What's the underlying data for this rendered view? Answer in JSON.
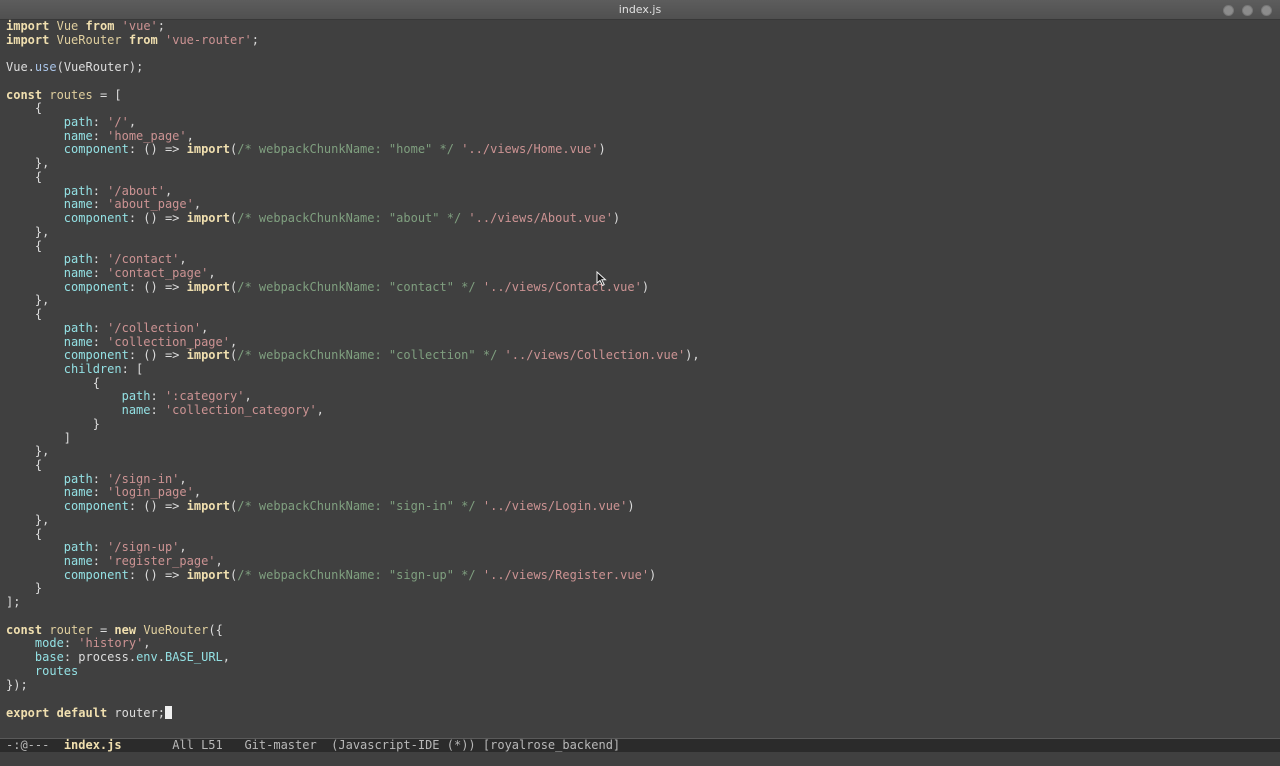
{
  "window": {
    "title": "index.js"
  },
  "code": [
    [
      [
        "kw",
        "import"
      ],
      [
        "punc",
        " "
      ],
      [
        "cls",
        "Vue"
      ],
      [
        "punc",
        " "
      ],
      [
        "kw",
        "from"
      ],
      [
        "punc",
        " "
      ],
      [
        "str",
        "'vue'"
      ],
      [
        "punc",
        ";"
      ]
    ],
    [
      [
        "kw",
        "import"
      ],
      [
        "punc",
        " "
      ],
      [
        "cls",
        "VueRouter"
      ],
      [
        "punc",
        " "
      ],
      [
        "kw",
        "from"
      ],
      [
        "punc",
        " "
      ],
      [
        "str",
        "'vue-router'"
      ],
      [
        "punc",
        ";"
      ]
    ],
    [],
    [
      [
        "punc",
        "Vue."
      ],
      [
        "fn",
        "use"
      ],
      [
        "punc",
        "(VueRouter);"
      ]
    ],
    [],
    [
      [
        "kw",
        "const"
      ],
      [
        "punc",
        " "
      ],
      [
        "var",
        "routes"
      ],
      [
        "punc",
        " = ["
      ]
    ],
    [
      [
        "punc",
        "    {"
      ]
    ],
    [
      [
        "punc",
        "        "
      ],
      [
        "prop",
        "path"
      ],
      [
        "punc",
        ": "
      ],
      [
        "str",
        "'/'"
      ],
      [
        "punc",
        ","
      ]
    ],
    [
      [
        "punc",
        "        "
      ],
      [
        "prop",
        "name"
      ],
      [
        "punc",
        ": "
      ],
      [
        "str",
        "'home_page'"
      ],
      [
        "punc",
        ","
      ]
    ],
    [
      [
        "punc",
        "        "
      ],
      [
        "prop",
        "component"
      ],
      [
        "punc",
        ": () => "
      ],
      [
        "kw",
        "import"
      ],
      [
        "punc",
        "("
      ],
      [
        "cmt",
        "/* webpackChunkName: \"home\" */"
      ],
      [
        "punc",
        " "
      ],
      [
        "str",
        "'../views/Home.vue'"
      ],
      [
        "punc",
        ")"
      ]
    ],
    [
      [
        "punc",
        "    },"
      ]
    ],
    [
      [
        "punc",
        "    {"
      ]
    ],
    [
      [
        "punc",
        "        "
      ],
      [
        "prop",
        "path"
      ],
      [
        "punc",
        ": "
      ],
      [
        "str",
        "'/about'"
      ],
      [
        "punc",
        ","
      ]
    ],
    [
      [
        "punc",
        "        "
      ],
      [
        "prop",
        "name"
      ],
      [
        "punc",
        ": "
      ],
      [
        "str",
        "'about_page'"
      ],
      [
        "punc",
        ","
      ]
    ],
    [
      [
        "punc",
        "        "
      ],
      [
        "prop",
        "component"
      ],
      [
        "punc",
        ": () => "
      ],
      [
        "kw",
        "import"
      ],
      [
        "punc",
        "("
      ],
      [
        "cmt",
        "/* webpackChunkName: \"about\" */"
      ],
      [
        "punc",
        " "
      ],
      [
        "str",
        "'../views/About.vue'"
      ],
      [
        "punc",
        ")"
      ]
    ],
    [
      [
        "punc",
        "    },"
      ]
    ],
    [
      [
        "punc",
        "    {"
      ]
    ],
    [
      [
        "punc",
        "        "
      ],
      [
        "prop",
        "path"
      ],
      [
        "punc",
        ": "
      ],
      [
        "str",
        "'/contact'"
      ],
      [
        "punc",
        ","
      ]
    ],
    [
      [
        "punc",
        "        "
      ],
      [
        "prop",
        "name"
      ],
      [
        "punc",
        ": "
      ],
      [
        "str",
        "'contact_page'"
      ],
      [
        "punc",
        ","
      ]
    ],
    [
      [
        "punc",
        "        "
      ],
      [
        "prop",
        "component"
      ],
      [
        "punc",
        ": () => "
      ],
      [
        "kw",
        "import"
      ],
      [
        "punc",
        "("
      ],
      [
        "cmt",
        "/* webpackChunkName: \"contact\" */"
      ],
      [
        "punc",
        " "
      ],
      [
        "str",
        "'../views/Contact.vue'"
      ],
      [
        "punc",
        ")"
      ]
    ],
    [
      [
        "punc",
        "    },"
      ]
    ],
    [
      [
        "punc",
        "    {"
      ]
    ],
    [
      [
        "punc",
        "        "
      ],
      [
        "prop",
        "path"
      ],
      [
        "punc",
        ": "
      ],
      [
        "str",
        "'/collection'"
      ],
      [
        "punc",
        ","
      ]
    ],
    [
      [
        "punc",
        "        "
      ],
      [
        "prop",
        "name"
      ],
      [
        "punc",
        ": "
      ],
      [
        "str",
        "'collection_page'"
      ],
      [
        "punc",
        ","
      ]
    ],
    [
      [
        "punc",
        "        "
      ],
      [
        "prop",
        "component"
      ],
      [
        "punc",
        ": () => "
      ],
      [
        "kw",
        "import"
      ],
      [
        "punc",
        "("
      ],
      [
        "cmt",
        "/* webpackChunkName: \"collection\" */"
      ],
      [
        "punc",
        " "
      ],
      [
        "str",
        "'../views/Collection.vue'"
      ],
      [
        "punc",
        "),"
      ]
    ],
    [
      [
        "punc",
        "        "
      ],
      [
        "prop",
        "children"
      ],
      [
        "punc",
        ": ["
      ]
    ],
    [
      [
        "punc",
        "            {"
      ]
    ],
    [
      [
        "punc",
        "                "
      ],
      [
        "prop",
        "path"
      ],
      [
        "punc",
        ": "
      ],
      [
        "str",
        "':category'"
      ],
      [
        "punc",
        ","
      ]
    ],
    [
      [
        "punc",
        "                "
      ],
      [
        "prop",
        "name"
      ],
      [
        "punc",
        ": "
      ],
      [
        "str",
        "'collection_category'"
      ],
      [
        "punc",
        ","
      ]
    ],
    [
      [
        "punc",
        "            }"
      ]
    ],
    [
      [
        "punc",
        "        ]"
      ]
    ],
    [
      [
        "punc",
        "    },"
      ]
    ],
    [
      [
        "punc",
        "    {"
      ]
    ],
    [
      [
        "punc",
        "        "
      ],
      [
        "prop",
        "path"
      ],
      [
        "punc",
        ": "
      ],
      [
        "str",
        "'/sign-in'"
      ],
      [
        "punc",
        ","
      ]
    ],
    [
      [
        "punc",
        "        "
      ],
      [
        "prop",
        "name"
      ],
      [
        "punc",
        ": "
      ],
      [
        "str",
        "'login_page'"
      ],
      [
        "punc",
        ","
      ]
    ],
    [
      [
        "punc",
        "        "
      ],
      [
        "prop",
        "component"
      ],
      [
        "punc",
        ": () => "
      ],
      [
        "kw",
        "import"
      ],
      [
        "punc",
        "("
      ],
      [
        "cmt",
        "/* webpackChunkName: \"sign-in\" */"
      ],
      [
        "punc",
        " "
      ],
      [
        "str",
        "'../views/Login.vue'"
      ],
      [
        "punc",
        ")"
      ]
    ],
    [
      [
        "punc",
        "    },"
      ]
    ],
    [
      [
        "punc",
        "    {"
      ]
    ],
    [
      [
        "punc",
        "        "
      ],
      [
        "prop",
        "path"
      ],
      [
        "punc",
        ": "
      ],
      [
        "str",
        "'/sign-up'"
      ],
      [
        "punc",
        ","
      ]
    ],
    [
      [
        "punc",
        "        "
      ],
      [
        "prop",
        "name"
      ],
      [
        "punc",
        ": "
      ],
      [
        "str",
        "'register_page'"
      ],
      [
        "punc",
        ","
      ]
    ],
    [
      [
        "punc",
        "        "
      ],
      [
        "prop",
        "component"
      ],
      [
        "punc",
        ": () => "
      ],
      [
        "kw",
        "import"
      ],
      [
        "punc",
        "("
      ],
      [
        "cmt",
        "/* webpackChunkName: \"sign-up\" */"
      ],
      [
        "punc",
        " "
      ],
      [
        "str",
        "'../views/Register.vue'"
      ],
      [
        "punc",
        ")"
      ]
    ],
    [
      [
        "punc",
        "    }"
      ]
    ],
    [
      [
        "punc",
        "];"
      ]
    ],
    [],
    [
      [
        "kw",
        "const"
      ],
      [
        "punc",
        " "
      ],
      [
        "var",
        "router"
      ],
      [
        "punc",
        " = "
      ],
      [
        "kw",
        "new"
      ],
      [
        "punc",
        " "
      ],
      [
        "cls",
        "VueRouter"
      ],
      [
        "punc",
        "({"
      ]
    ],
    [
      [
        "punc",
        "    "
      ],
      [
        "prop",
        "mode"
      ],
      [
        "punc",
        ": "
      ],
      [
        "str",
        "'history'"
      ],
      [
        "punc",
        ","
      ]
    ],
    [
      [
        "punc",
        "    "
      ],
      [
        "prop",
        "base"
      ],
      [
        "punc",
        ": process."
      ],
      [
        "prop",
        "env"
      ],
      [
        "punc",
        "."
      ],
      [
        "prop",
        "BASE_URL"
      ],
      [
        "punc",
        ","
      ]
    ],
    [
      [
        "punc",
        "    "
      ],
      [
        "prop",
        "routes"
      ]
    ],
    [
      [
        "punc",
        "});"
      ]
    ],
    [],
    [
      [
        "kw",
        "export"
      ],
      [
        "punc",
        " "
      ],
      [
        "kw",
        "default"
      ],
      [
        "punc",
        " router;"
      ]
    ]
  ],
  "modeline": {
    "status": "-:@---",
    "buffer": "index.js",
    "position": "All L51",
    "vcs": "Git-master",
    "modes": "(Javascript-IDE (*))",
    "project": "[royalrose_backend]"
  },
  "colors": {
    "background": "#404040",
    "keyword": "#f0dfaf",
    "string": "#cc9393",
    "comment": "#7f9f7f",
    "property": "#93e0e3"
  }
}
